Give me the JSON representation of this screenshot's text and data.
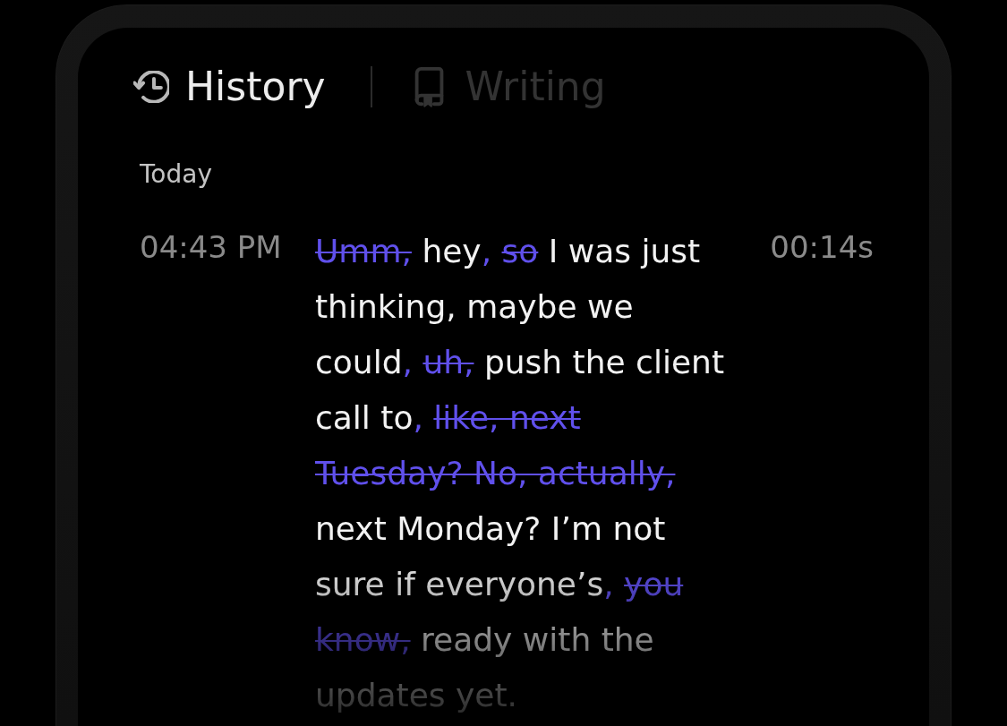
{
  "tabs": [
    {
      "label": "History",
      "selected": true
    },
    {
      "label": "Writing",
      "selected": false
    }
  ],
  "sections": [
    {
      "title": "Today",
      "entries": [
        {
          "time": "04:43 PM",
          "duration": "00:14s",
          "segments": [
            {
              "kind": "removed",
              "text": "Umm,"
            },
            {
              "kind": "text",
              "text": " hey"
            },
            {
              "kind": "added",
              "text": ", "
            },
            {
              "kind": "removed",
              "text": "so"
            },
            {
              "kind": "text",
              "text": " I was just thinking, maybe we could"
            },
            {
              "kind": "added",
              "text": ", "
            },
            {
              "kind": "removed",
              "text": "uh,"
            },
            {
              "kind": "text",
              "text": " push the client call to"
            },
            {
              "kind": "added",
              "text": ", "
            },
            {
              "kind": "removed",
              "text": "like, next Tuesday? No, actually,"
            },
            {
              "kind": "text",
              "text": " next Monday? I’m not sure if everyone’s"
            },
            {
              "kind": "added",
              "text": ", "
            },
            {
              "kind": "removed",
              "text": "you know,"
            },
            {
              "kind": "text",
              "text": " ready with the updates yet."
            }
          ]
        }
      ]
    }
  ]
}
